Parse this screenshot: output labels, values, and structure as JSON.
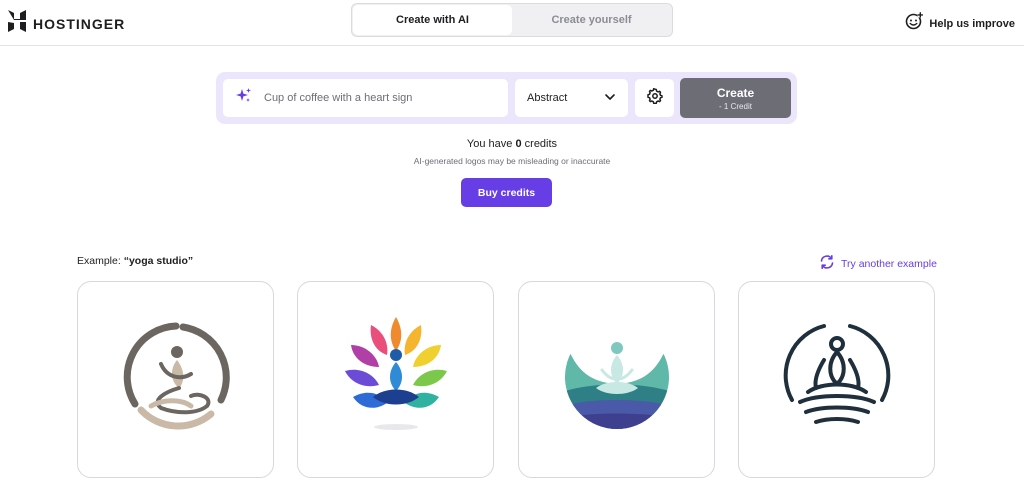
{
  "header": {
    "brand": "HOSTINGER",
    "tabs": [
      {
        "label": "Create with AI",
        "active": true
      },
      {
        "label": "Create yourself",
        "active": false
      }
    ],
    "help_label": "Help us improve",
    "icons": {
      "brand": "hostinger-logo-icon",
      "help": "smiley-feedback-icon"
    }
  },
  "prompt": {
    "placeholder": "Cup of coffee with a heart sign",
    "value": "",
    "style_selected": "Abstract",
    "create_label": "Create",
    "create_cost": "- 1 Credit",
    "icons": {
      "input": "sparkle-icon",
      "select": "chevron-down-icon",
      "settings": "gear-icon"
    }
  },
  "credits": {
    "prefix": "You have",
    "count": "0",
    "suffix": "credits",
    "disclaimer": "AI-generated logos may be misleading or inaccurate",
    "buy_label": "Buy credits"
  },
  "examples": {
    "label": "Example:",
    "term": "“yoga studio”",
    "try_another_label": "Try another example",
    "logos": [
      "yoga-logo-circle-pose-icon",
      "yoga-logo-lotus-colorful-icon",
      "yoga-logo-meditation-teal-icon",
      "yoga-logo-lotus-outline-icon"
    ]
  },
  "colors": {
    "accent": "#673de6",
    "prompt_bg": "#ebe6fb",
    "create_disabled": "#6d6e75",
    "text": "#1d1e20"
  }
}
